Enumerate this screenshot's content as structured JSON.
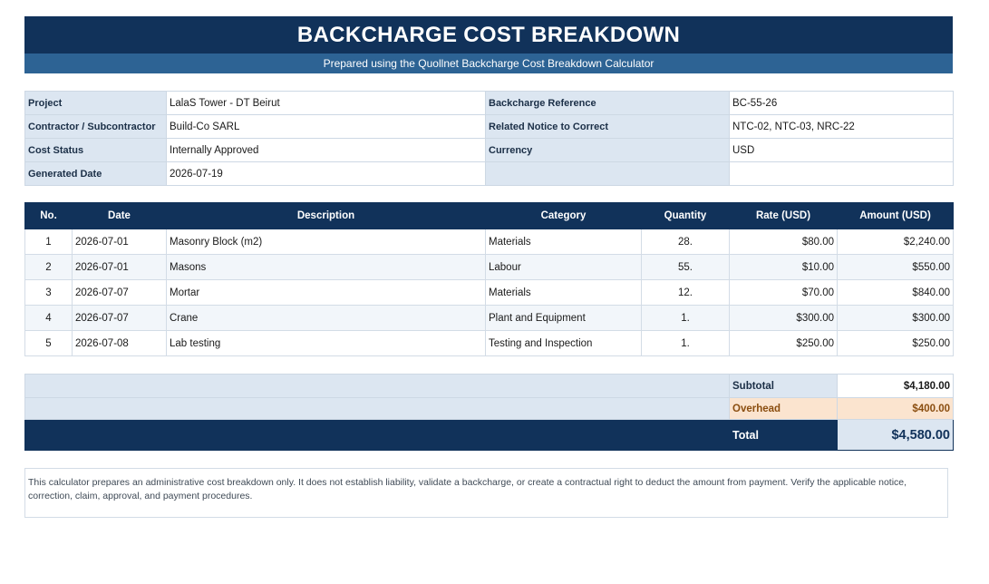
{
  "header": {
    "title": "BACKCHARGE COST BREAKDOWN",
    "subtitle": "Prepared using the Quollnet Backcharge Cost Breakdown Calculator"
  },
  "info": {
    "project_label": "Project",
    "project_value": "LalaS Tower - DT Beirut",
    "contractor_label": "Contractor / Subcontractor",
    "contractor_value": "Build-Co SARL",
    "status_label": "Cost Status",
    "status_value": "Internally Approved",
    "generated_label": "Generated Date",
    "generated_value": "2026-07-19",
    "reference_label": "Backcharge Reference",
    "reference_value": "BC-55-26",
    "notice_label": "Related Notice to Correct",
    "notice_value": "NTC-02, NTC-03, NRC-22",
    "currency_label": "Currency",
    "currency_value": "USD"
  },
  "items": {
    "headers": {
      "no": "No.",
      "date": "Date",
      "description": "Description",
      "category": "Category",
      "quantity": "Quantity",
      "rate": "Rate (USD)",
      "amount": "Amount (USD)"
    },
    "rows": [
      {
        "no": "1",
        "date": "2026-07-01",
        "description": "Masonry Block (m2)",
        "category": "Materials",
        "quantity": "28.",
        "rate": "$80.00",
        "amount": "$2,240.00"
      },
      {
        "no": "2",
        "date": "2026-07-01",
        "description": "Masons",
        "category": "Labour",
        "quantity": "55.",
        "rate": "$10.00",
        "amount": "$550.00"
      },
      {
        "no": "3",
        "date": "2026-07-07",
        "description": "Mortar",
        "category": "Materials",
        "quantity": "12.",
        "rate": "$70.00",
        "amount": "$840.00"
      },
      {
        "no": "4",
        "date": "2026-07-07",
        "description": "Crane",
        "category": "Plant and Equipment",
        "quantity": "1.",
        "rate": "$300.00",
        "amount": "$300.00"
      },
      {
        "no": "5",
        "date": "2026-07-08",
        "description": "Lab testing",
        "category": "Testing and Inspection",
        "quantity": "1.",
        "rate": "$250.00",
        "amount": "$250.00"
      }
    ]
  },
  "totals": {
    "subtotal_label": "Subtotal",
    "subtotal_value": "$4,180.00",
    "overhead_label": "Overhead",
    "overhead_value": "$400.00",
    "total_label": "Total",
    "total_value": "$4,580.00"
  },
  "disclaimer": "This calculator prepares an administrative cost breakdown only. It does not establish liability, validate a backcharge, or create a contractual right to deduct the amount from payment. Verify the applicable notice, correction, claim, approval, and payment procedures.",
  "colors": {
    "header_navy": "#11325a",
    "subtitle_blue": "#2d6394",
    "label_fill": "#dce6f1",
    "overhead_fill": "#fbe4cf",
    "overhead_text": "#8a4d0f"
  }
}
